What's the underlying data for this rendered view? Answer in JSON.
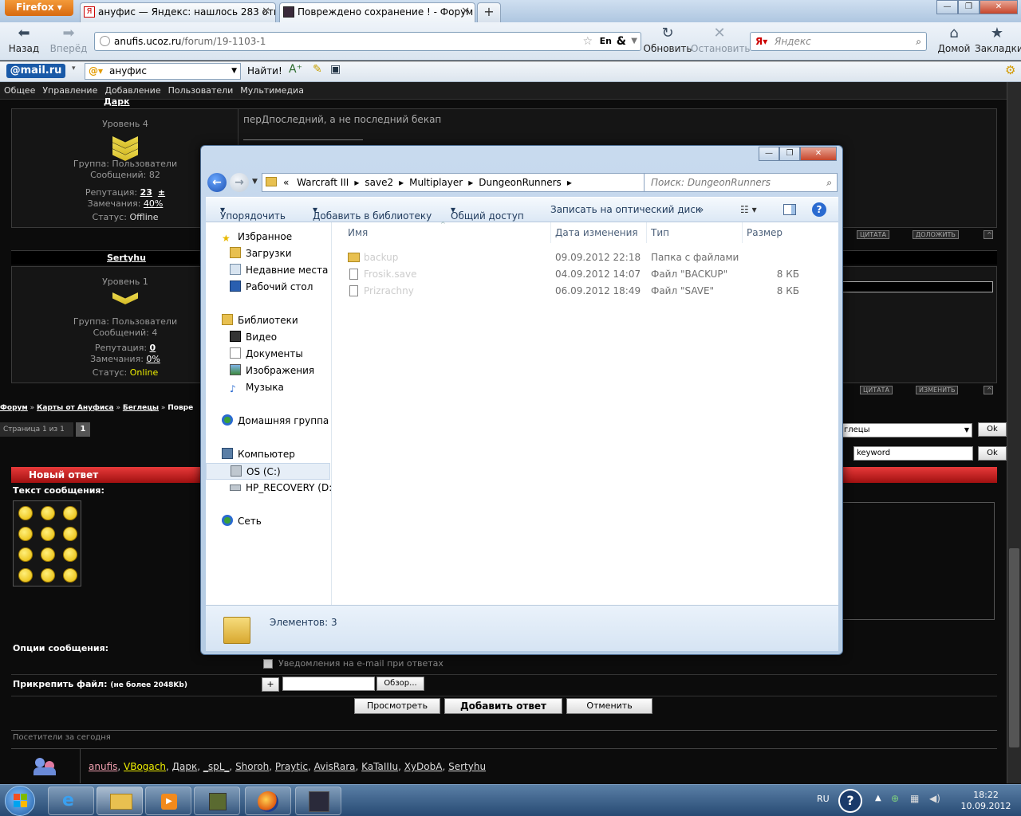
{
  "browser": {
    "menu_label": "Firefox",
    "tabs": [
      {
        "title": "ануфис — Яндекс: нашлось 283 отв..."
      },
      {
        "title": "Повреждено сохранение ! - Форум"
      }
    ],
    "new_tab": "+",
    "nav": {
      "back": "Назад",
      "forward": "Вперёд",
      "reload": "Обновить",
      "stop": "Остановить",
      "home": "Домой",
      "bookmarks": "Закладки"
    },
    "url_host": "anufis.ucoz.ru",
    "url_path": "/forum/19-1103-1",
    "search_placeholder": "Яндекс",
    "mail_logo": "@mail.ru",
    "mail_query": "ануфис",
    "mail_go": "Найти!"
  },
  "forum": {
    "menu": [
      "Общее",
      "Управление",
      "Добавление",
      "Пользователи",
      "Мультимедиа"
    ],
    "post1": {
      "author": "Дарк",
      "level": "Уровень 4",
      "group": "Группа: Пользователи",
      "messages": "Сообщений: 82",
      "rep_label": "Репутация:",
      "rep_value": "23",
      "rep_plus": "±",
      "warn_label": "Замечания:",
      "warn_value": "40%",
      "status_label": "Статус:",
      "status_value": "Offline",
      "text": "перДпоследний, а не последний бекап",
      "quote_btn": "ЦИТАТА",
      "report_btn": "ДОЛОЖИТЬ"
    },
    "post2": {
      "author": "Sertyhu",
      "level": "Уровень 1",
      "group": "Группа: Пользователи",
      "messages": "Сообщений: 4",
      "rep_label": "Репутация:",
      "rep_value": "0",
      "warn_label": "Замечания:",
      "warn_value": "0%",
      "status_label": "Статус:",
      "status_value": "Online",
      "quote_btn": "ЦИТАТА",
      "edit_btn": "ИЗМЕНИТЬ"
    },
    "breadcrumb": [
      "Форум",
      "Карты от Ануфиса",
      "Беглецы",
      "Повре"
    ],
    "pages_label": "Страница 1 из 1",
    "page_current": "1",
    "select_value": "глецы",
    "ok": "Ok",
    "keyword": "keyword",
    "new_reply": "Новый ответ",
    "message_text": "Текст сообщения:",
    "options_label": "Опции сообщения:",
    "notify_label": "Уведомления на e-mail при ответах",
    "attach_label": "Прикрепить файл:",
    "attach_limit": "(не более 2048Kb)",
    "attach_plus": "+",
    "browse": "Обзор...",
    "preview_btn": "Просмотреть",
    "submit_btn": "Добавить ответ",
    "cancel_btn": "Отменить",
    "visitors_title": "Посетители за сегодня",
    "visitors": [
      "anufis",
      "VBogach",
      "Дарк",
      "_spL_",
      "Shoroh",
      "Praytic",
      "AvisRara",
      "KaTaIIIu",
      "XyDobA",
      "Sertyhu"
    ]
  },
  "explorer": {
    "breadcrumb": [
      "Warcraft III",
      "save2",
      "Multiplayer",
      "DungeonRunners"
    ],
    "search_placeholder": "Поиск: DungeonRunners",
    "toolbar": [
      "Упорядочить",
      "Добавить в библиотеку",
      "Общий доступ",
      "Записать на оптический диск",
      "»"
    ],
    "nav": {
      "favorites": "Избранное",
      "downloads": "Загрузки",
      "recent": "Недавние места",
      "desktop": "Рабочий стол",
      "libraries": "Библиотеки",
      "video": "Видео",
      "docs": "Документы",
      "images": "Изображения",
      "music": "Музыка",
      "homegroup": "Домашняя группа",
      "computer": "Компьютер",
      "os": "OS (C:)",
      "recovery": "HP_RECOVERY (D:)",
      "network": "Сеть"
    },
    "columns": {
      "name": "Имя",
      "date": "Дата изменения",
      "type": "Тип",
      "size": "Размер"
    },
    "files": [
      {
        "name": "backup",
        "date": "09.09.2012 22:18",
        "type": "Папка с файлами",
        "size": ""
      },
      {
        "name": "Frosik.save",
        "date": "04.09.2012 14:07",
        "type": "Файл \"BACKUP\"",
        "size": "8 КБ"
      },
      {
        "name": "Prizrachny",
        "date": "06.09.2012 18:49",
        "type": "Файл \"SAVE\"",
        "size": "8 КБ"
      }
    ],
    "status": "Элементов: 3"
  },
  "taskbar": {
    "lang": "RU",
    "time": "18:22",
    "date": "10.09.2012"
  }
}
